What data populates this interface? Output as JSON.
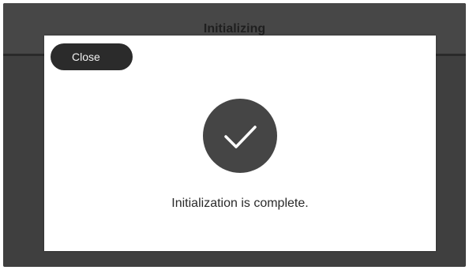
{
  "window": {
    "title": "Initializing"
  },
  "dialog": {
    "close_label": "Close",
    "status_icon": "checkmark-icon",
    "message": "Initialization is complete."
  },
  "colors": {
    "screen_background": "#3f3f3f",
    "dialog_background": "#ffffff",
    "button_background": "#2b2b2b",
    "icon_circle": "#454545"
  }
}
